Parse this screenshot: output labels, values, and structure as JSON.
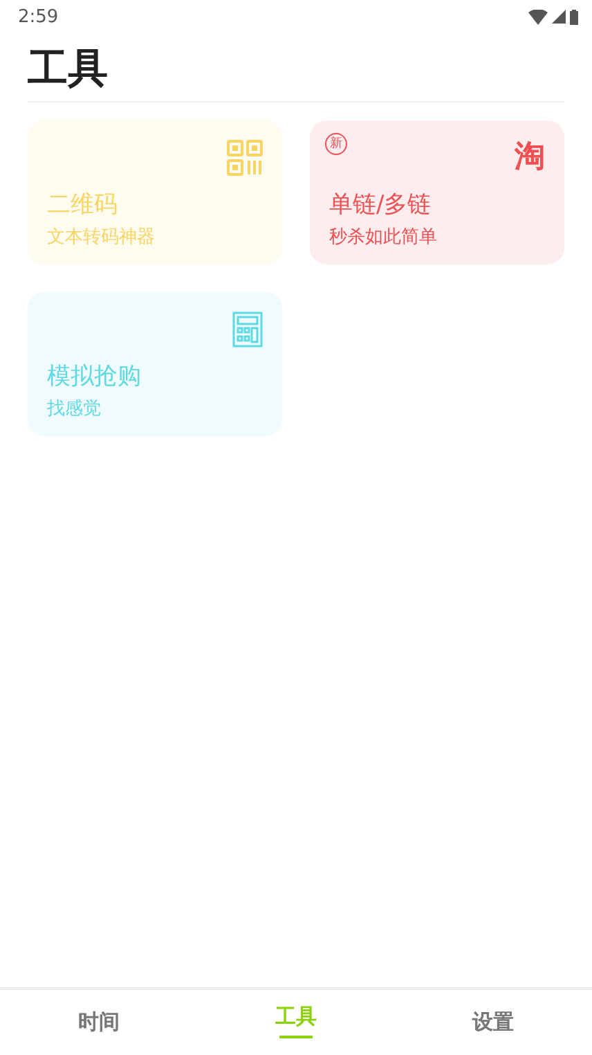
{
  "status_bar": {
    "time": "2:59"
  },
  "title": "工具",
  "tools": [
    {
      "kind": "qr",
      "title": "二维码",
      "subtitle": "文本转码神器",
      "color": "#f8d462"
    },
    {
      "kind": "taobao",
      "title": "单链/多链",
      "subtitle": "秒杀如此简单",
      "color": "#ee4f52",
      "badge": "新",
      "logo": "淘"
    },
    {
      "kind": "calculator",
      "title": "模拟抢购",
      "subtitle": "找感觉",
      "color": "#5cd9e2"
    }
  ],
  "tabs": [
    {
      "label": "时间",
      "selected": false
    },
    {
      "label": "工具",
      "selected": true
    },
    {
      "label": "设置",
      "selected": false
    }
  ]
}
